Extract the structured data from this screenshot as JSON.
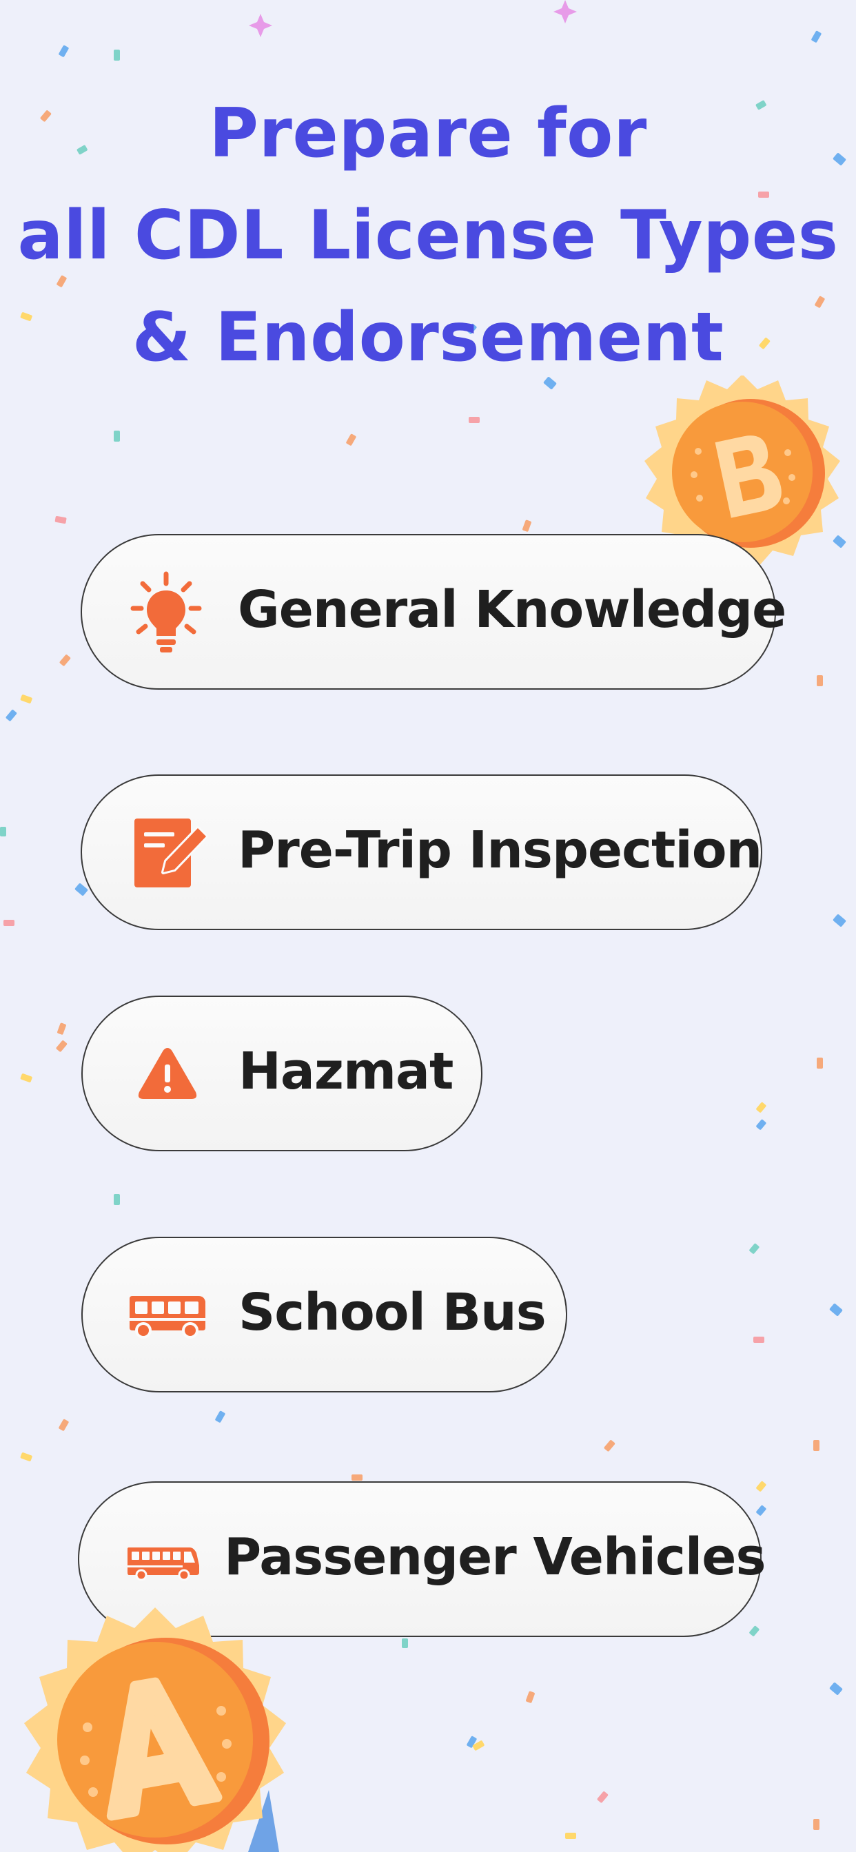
{
  "headline": {
    "line1": "Prepare for",
    "line2": "all CDL License Types",
    "line3": "& Endorsement"
  },
  "topics": [
    {
      "label": "General Knowledge",
      "icon": "lightbulb-icon"
    },
    {
      "label": "Pre-Trip Inspection",
      "icon": "edit-note-icon"
    },
    {
      "label": "Hazmat",
      "icon": "warning-icon"
    },
    {
      "label": "School Bus",
      "icon": "bus-icon"
    },
    {
      "label": "Passenger Vehicles",
      "icon": "coach-bus-icon"
    }
  ],
  "badges": [
    {
      "letter": "B",
      "name": "badge-b"
    },
    {
      "letter": "A",
      "name": "badge-a"
    }
  ],
  "colors": {
    "background": "#eef0fa",
    "headline": "#4a4ae0",
    "icon": "#f26b3a",
    "label": "#1f1f1f",
    "badge_outer": "#ffd58a",
    "badge_inner": "#f89a3c"
  }
}
